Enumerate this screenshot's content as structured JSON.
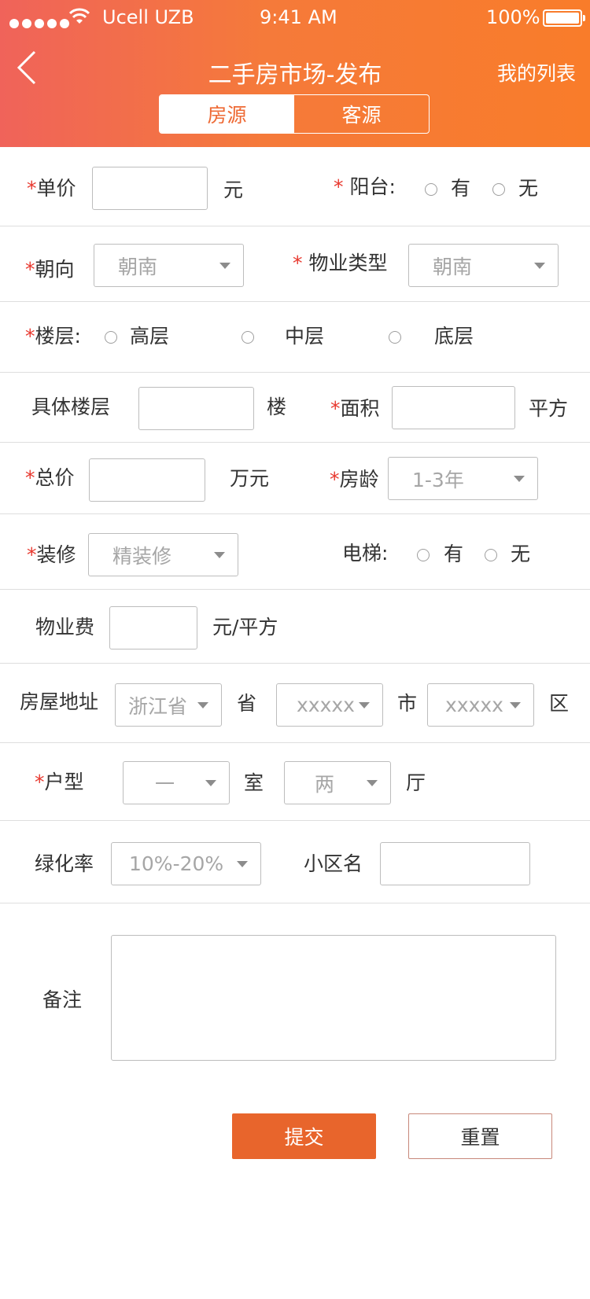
{
  "status_bar": {
    "carrier": "Ucell UZB",
    "time": "9:41 AM",
    "battery": "100%"
  },
  "nav": {
    "title": "二手房市场-发布",
    "right_link": "我的列表"
  },
  "tabs": [
    {
      "label": "房源",
      "active": true
    },
    {
      "label": "客源",
      "active": false
    }
  ],
  "colors": {
    "accent": "#e8652c",
    "required": "#e8392f",
    "header_start": "#f0635a",
    "header_end": "#f97c2a"
  },
  "form": {
    "unit_price": {
      "req": "*",
      "label": "单价",
      "unit": "元"
    },
    "balcony": {
      "req": "*",
      "label": "阳台:",
      "options": [
        "有",
        "无"
      ]
    },
    "orientation": {
      "req": "*",
      "label": "朝向",
      "value": "朝南"
    },
    "property_type": {
      "req": "*",
      "label": "物业类型",
      "value": "朝南"
    },
    "floor_level": {
      "req": "*",
      "label": "楼层:",
      "options": [
        "高层",
        "中层",
        "底层"
      ]
    },
    "specific_floor": {
      "label": "具体楼层",
      "unit": "楼"
    },
    "area": {
      "req": "*",
      "label": "面积",
      "unit": "平方"
    },
    "total_price": {
      "req": "*",
      "label": "总价",
      "unit": "万元"
    },
    "house_age": {
      "req": "*",
      "label": "房龄",
      "value": "1-3年"
    },
    "decoration": {
      "req": "*",
      "label": "装修",
      "value": "精装修"
    },
    "elevator": {
      "label": "电梯:",
      "options": [
        "有",
        "无"
      ]
    },
    "property_fee": {
      "label": "物业费",
      "unit": "元/平方"
    },
    "address": {
      "label": "房屋地址",
      "province": "浙江省",
      "province_unit": "省",
      "city": "xxxxx",
      "city_unit": "市",
      "district": "xxxxx",
      "district_unit": "区"
    },
    "layout": {
      "req": "*",
      "label": "户型",
      "rooms": "一",
      "rooms_unit": "室",
      "halls": "两",
      "halls_unit": "厅"
    },
    "greening": {
      "label": "绿化率",
      "value": "10%-20%"
    },
    "community": {
      "label": "小区名"
    },
    "remarks": {
      "label": "备注"
    }
  },
  "buttons": {
    "submit": "提交",
    "reset": "重置"
  }
}
